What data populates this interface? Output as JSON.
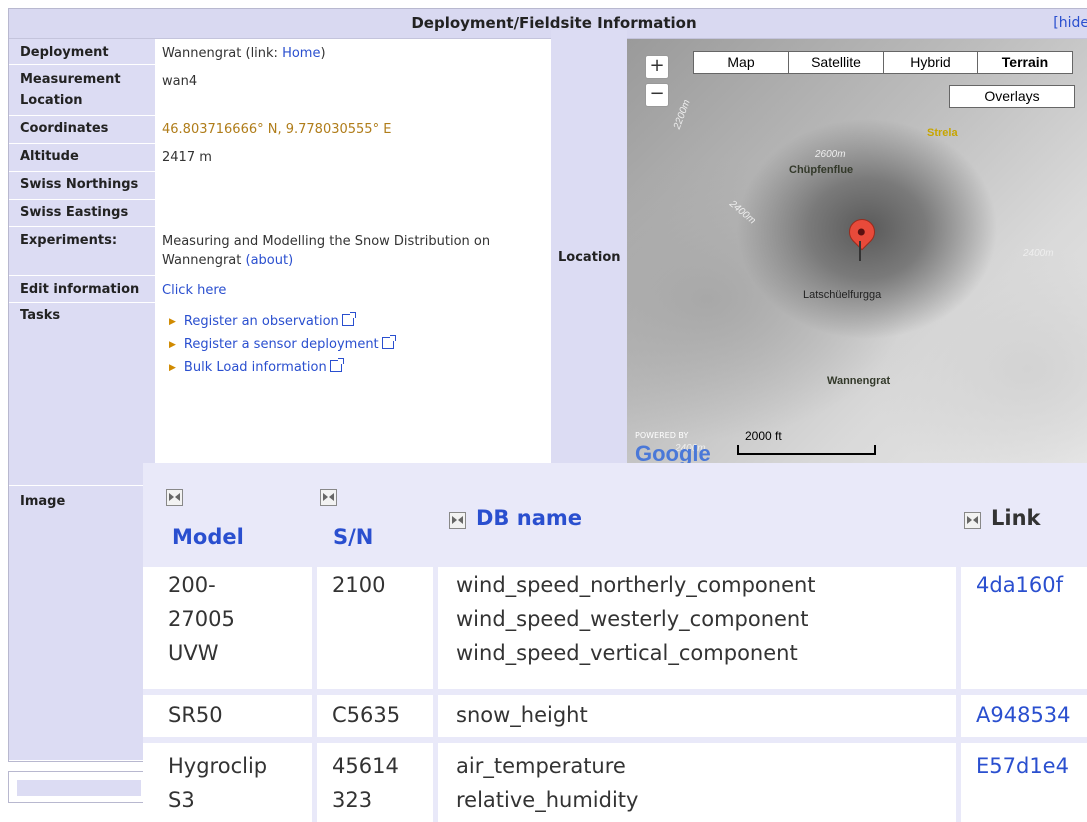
{
  "header": {
    "title": "Deployment/Fieldsite Information",
    "hide_link": "[hide"
  },
  "fields": {
    "deployment_label": "Deployment",
    "deployment_value": "Wannengrat (link: ",
    "deployment_link": "Home",
    "deployment_close": ")",
    "measurement_label": "Measurement Location",
    "measurement_value": "wan4",
    "coordinates_label": "Coordinates",
    "coordinates_value": "46.803716666° N, 9.778030555° E",
    "altitude_label": "Altitude",
    "altitude_value": "2417 m",
    "swiss_northings_label": "Swiss Northings",
    "swiss_eastings_label": "Swiss Eastings",
    "experiments_label": "Experiments:",
    "experiments_value": "Measuring and Modelling the Snow Distribution on Wannengrat",
    "experiments_link": "(about)",
    "edit_label": "Edit information",
    "edit_link": "Click here",
    "tasks_label": "Tasks",
    "tasks": [
      "Register an observation",
      "Register a sensor deployment",
      "Bulk Load information"
    ],
    "image_label": "Image",
    "location_label": "Location"
  },
  "map": {
    "buttons": [
      "Map",
      "Satellite",
      "Hybrid",
      "Terrain"
    ],
    "active_button": "Terrain",
    "overlays": "Overlays",
    "zoom_in": "+",
    "zoom_out": "−",
    "labels": {
      "strela": "Strela",
      "chupfenflue": "Chüpfenflue",
      "latschuelfurgga": "Latschüelfurgga",
      "wannengrat": "Wannengrat"
    },
    "contours": [
      "2200m",
      "2600m",
      "2400m",
      "2400m",
      "2400m"
    ],
    "scale": "2000 ft",
    "powered_by": "POWERED BY",
    "google": "Google"
  },
  "table": {
    "headers": [
      "Model",
      "S/N",
      "DB name",
      "Link"
    ],
    "rows": [
      {
        "model": [
          "200-",
          "27005",
          "UVW"
        ],
        "sn": [
          "2100"
        ],
        "db": [
          "wind_speed_northerly_component",
          "wind_speed_westerly_component",
          "wind_speed_vertical_component"
        ],
        "link": "4da160f"
      },
      {
        "model": [
          "SR50"
        ],
        "sn": [
          "C5635"
        ],
        "db": [
          "snow_height"
        ],
        "link": "A948534"
      },
      {
        "model": [
          "Hygroclip",
          "S3"
        ],
        "sn": [
          "45614",
          "323"
        ],
        "db": [
          "air_temperature",
          "relative_humidity"
        ],
        "link": "E57d1e4"
      }
    ]
  },
  "colors": {
    "header_bg": "#d9d9f1",
    "label_bg": "#dcdcf3",
    "link": "#2a4fcf",
    "coord": "#b07d1a"
  }
}
